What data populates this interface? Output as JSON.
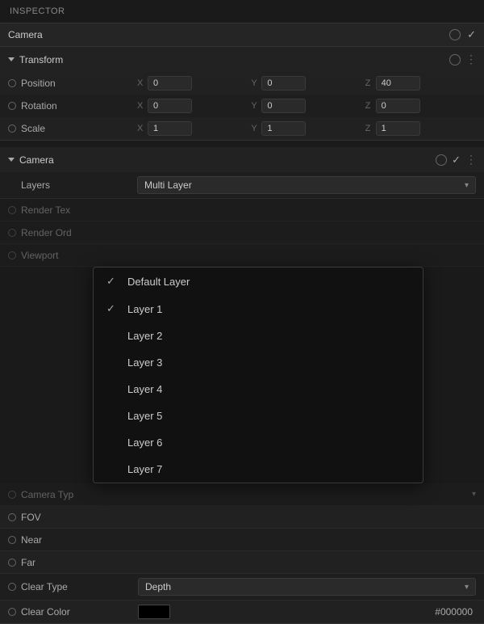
{
  "inspector": {
    "title": "INSPECTOR"
  },
  "camera_selector": {
    "name": "Camera",
    "icon_circle": "",
    "checkmark": "✓"
  },
  "transform": {
    "label": "Transform",
    "position": {
      "label": "Position",
      "x": "0",
      "y": "0",
      "z": "40"
    },
    "rotation": {
      "label": "Rotation",
      "x": "0",
      "y": "0",
      "z": "0"
    },
    "scale": {
      "label": "Scale",
      "x": "1",
      "y": "1",
      "z": "1"
    }
  },
  "camera": {
    "label": "Camera",
    "checkmark": "✓",
    "layers": {
      "label": "Layers",
      "value": "Multi Layer"
    },
    "render_texture": {
      "label": "Render Tex"
    },
    "render_order": {
      "label": "Render Ord"
    },
    "viewport": {
      "label": "Viewport"
    },
    "camera_type": {
      "label": "Camera Typ"
    },
    "fov": {
      "label": "FOV"
    },
    "near": {
      "label": "Near"
    },
    "far": {
      "label": "Far"
    },
    "clear_type": {
      "label": "Clear Type",
      "value": "Depth"
    },
    "clear_color": {
      "label": "Clear Color",
      "color": "#000000",
      "hex": "#000000"
    }
  },
  "dropdown": {
    "items": [
      {
        "label": "Default Layer",
        "checked": true
      },
      {
        "label": "Layer 1",
        "checked": true
      },
      {
        "label": "Layer 2",
        "checked": false
      },
      {
        "label": "Layer 3",
        "checked": false
      },
      {
        "label": "Layer 4",
        "checked": false
      },
      {
        "label": "Layer 5",
        "checked": false
      },
      {
        "label": "Layer 6",
        "checked": false
      },
      {
        "label": "Layer 7",
        "checked": false
      }
    ]
  }
}
